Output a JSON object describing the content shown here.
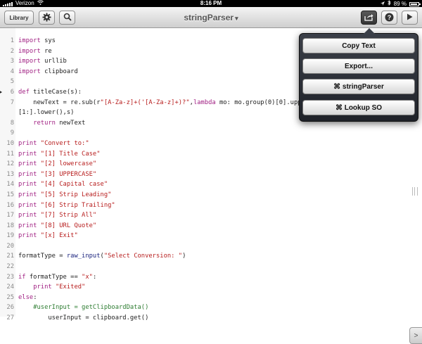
{
  "status_bar": {
    "carrier": "Verizon",
    "time": "8:16 PM",
    "battery": "89 %",
    "battery_level": 0.89,
    "icons": [
      "signal-icon",
      "wifi-icon",
      "location-icon",
      "bluetooth-icon",
      "battery-icon"
    ]
  },
  "toolbar": {
    "library_label": "Library",
    "title": "stringParser",
    "title_chevron": "▾",
    "icons": [
      "gear-icon",
      "search-icon",
      "share-icon",
      "help-icon",
      "play-icon"
    ]
  },
  "popover": {
    "items": [
      "Copy Text",
      "Export...",
      "⌘ stringParser",
      "⌘ Lookup SO"
    ]
  },
  "editor": {
    "lines": [
      {
        "n": "1",
        "t": "import sys"
      },
      {
        "n": "2",
        "t": "import re"
      },
      {
        "n": "3",
        "t": "import urllib"
      },
      {
        "n": "4",
        "t": "import clipboard"
      },
      {
        "n": "5",
        "t": ""
      },
      {
        "n": "6",
        "t": "def titleCase(s):",
        "marker": true
      },
      {
        "n": "7",
        "t": "    newText = re.sub(r\"[A-Za-z]+('[A-Za-z]+)?\",lambda mo: mo.group(0)[0].upp"
      },
      {
        "n": "",
        "t": "[1:].lower(),s)"
      },
      {
        "n": "8",
        "t": "    return newText"
      },
      {
        "n": "9",
        "t": ""
      },
      {
        "n": "10",
        "t": "print \"Convert to:\""
      },
      {
        "n": "11",
        "t": "print \"[1] Title Case\""
      },
      {
        "n": "12",
        "t": "print \"[2] lowercase\""
      },
      {
        "n": "13",
        "t": "print \"[3] UPPERCASE\""
      },
      {
        "n": "14",
        "t": "print \"[4] Capital case\""
      },
      {
        "n": "15",
        "t": "print \"[5] Strip Leading\""
      },
      {
        "n": "16",
        "t": "print \"[6] Strip Trailing\""
      },
      {
        "n": "17",
        "t": "print \"[7] Strip All\""
      },
      {
        "n": "18",
        "t": "print \"[8] URL Quote\""
      },
      {
        "n": "19",
        "t": "print \"[x] Exit\""
      },
      {
        "n": "20",
        "t": ""
      },
      {
        "n": "21",
        "t": "formatType = raw_input(\"Select Conversion: \")"
      },
      {
        "n": "22",
        "t": ""
      },
      {
        "n": "23",
        "t": "if formatType == \"x\":"
      },
      {
        "n": "24",
        "t": "    print \"Exited\""
      },
      {
        "n": "25",
        "t": "else:"
      },
      {
        "n": "26",
        "t": "    #userInput = getClipboardData()"
      },
      {
        "n": "27",
        "t": "        userInput = clipboard.get()"
      }
    ]
  },
  "colors": {
    "keyword": "#a01f82",
    "string": "#b71c1c",
    "comment": "#2e7d32",
    "builtin": "#1a237e"
  }
}
